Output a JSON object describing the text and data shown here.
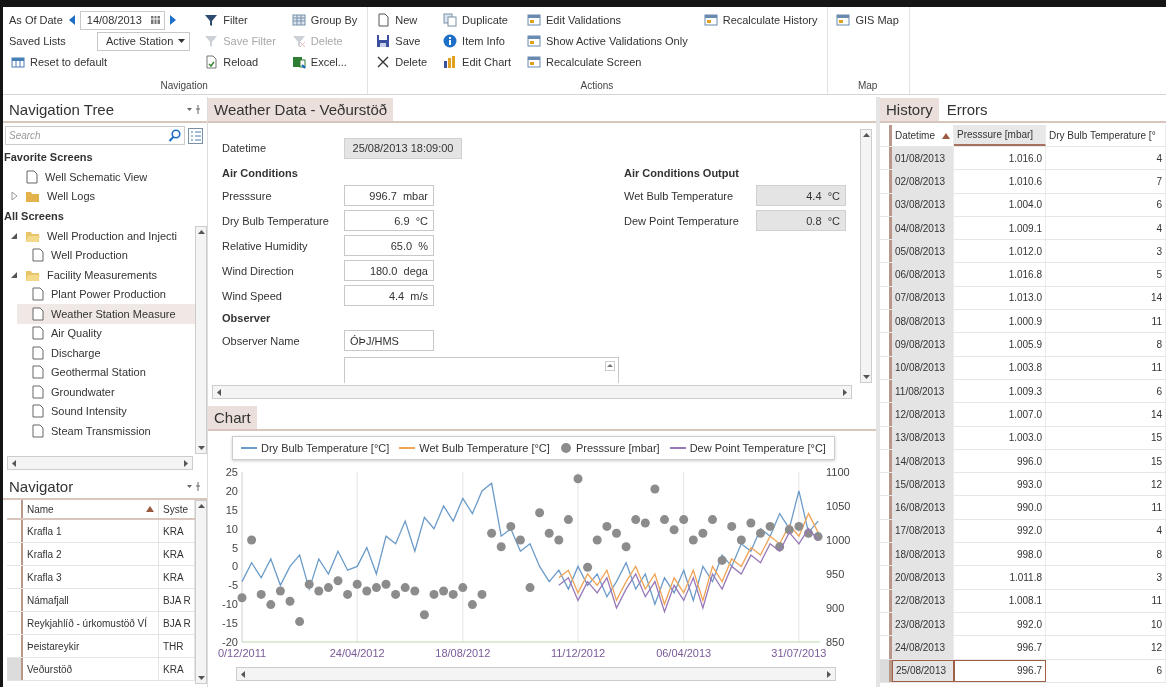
{
  "ribbon": {
    "groups": [
      {
        "label": "Navigation",
        "columns": [
          [
            {
              "kind": "date",
              "label": "As Of Date",
              "value": "14/08/2013"
            },
            {
              "kind": "dropdown",
              "label": "Saved Lists",
              "value": "Active Station"
            },
            {
              "kind": "button",
              "label": "Reset to default",
              "disabled": false
            }
          ],
          [
            {
              "kind": "button",
              "label": "Filter",
              "disabled": false
            },
            {
              "kind": "button",
              "label": "Save Filter",
              "disabled": true
            },
            {
              "kind": "button",
              "label": "Reload",
              "disabled": false
            }
          ],
          [
            {
              "kind": "button",
              "label": "Group By",
              "disabled": false
            },
            {
              "kind": "button",
              "label": "Delete",
              "disabled": true
            },
            {
              "kind": "button",
              "label": "Excel...",
              "disabled": false
            }
          ]
        ]
      },
      {
        "label": "Actions",
        "columns": [
          [
            {
              "kind": "button",
              "label": "New",
              "disabled": false
            },
            {
              "kind": "button",
              "label": "Save",
              "disabled": false
            },
            {
              "kind": "button",
              "label": "Delete",
              "disabled": false
            }
          ],
          [
            {
              "kind": "button",
              "label": "Duplicate",
              "disabled": false
            },
            {
              "kind": "button",
              "label": "Item Info",
              "disabled": false
            },
            {
              "kind": "button",
              "label": "Edit Chart",
              "disabled": false
            }
          ],
          [
            {
              "kind": "button",
              "label": "Edit Validations",
              "disabled": false
            },
            {
              "kind": "button",
              "label": "Show Active Validations Only",
              "disabled": false
            },
            {
              "kind": "button",
              "label": "Recalculate Screen",
              "disabled": false
            }
          ],
          [
            {
              "kind": "button",
              "label": "Recalculate History",
              "disabled": false
            }
          ]
        ]
      },
      {
        "label": "Map",
        "columns": [
          [
            {
              "kind": "button",
              "label": "GIS Map",
              "disabled": false
            }
          ]
        ]
      }
    ]
  },
  "navigation_tree": {
    "title": "Navigation Tree",
    "search": {
      "placeholder": "Search"
    },
    "sections": [
      {
        "label": "Favorite Screens",
        "items": [
          {
            "kind": "page",
            "label": "Well Schematic View",
            "selected": false
          },
          {
            "kind": "folder",
            "label": "Well Logs",
            "expanded": false,
            "selected": false
          }
        ]
      },
      {
        "label": "All Screens",
        "items": [
          {
            "kind": "folder",
            "label": "Well Production and Injecti",
            "expanded": true,
            "selected": false,
            "children": [
              {
                "kind": "page",
                "label": "Well Production",
                "selected": false
              }
            ]
          },
          {
            "kind": "folder",
            "label": "Facility Measurements",
            "expanded": true,
            "selected": false,
            "children": [
              {
                "kind": "page",
                "label": "Plant Power Production",
                "selected": false
              },
              {
                "kind": "page",
                "label": "Weather Station Measure",
                "selected": true
              },
              {
                "kind": "page",
                "label": "Air Quality",
                "selected": false
              },
              {
                "kind": "page",
                "label": "Discharge",
                "selected": false
              },
              {
                "kind": "page",
                "label": "Geothermal Station",
                "selected": false
              },
              {
                "kind": "page",
                "label": "Groundwater",
                "selected": false
              },
              {
                "kind": "page",
                "label": "Sound Intensity",
                "selected": false
              },
              {
                "kind": "page",
                "label": "Steam Transmission",
                "selected": false
              }
            ]
          }
        ]
      }
    ]
  },
  "navigator": {
    "title": "Navigator",
    "columns": [
      {
        "label": "Name",
        "sorted": true
      },
      {
        "label": "Syste",
        "sorted": false
      }
    ],
    "rows": [
      {
        "cells": [
          "Krafla 1",
          "KRA"
        ],
        "selected": false
      },
      {
        "cells": [
          "Krafla 2",
          "KRA"
        ],
        "selected": false
      },
      {
        "cells": [
          "Krafla 3",
          "KRA"
        ],
        "selected": false
      },
      {
        "cells": [
          "Námafjall",
          "BJA R"
        ],
        "selected": false
      },
      {
        "cells": [
          "Reykjahlíð - úrkomustöð VÍ",
          "BJA R"
        ],
        "selected": false
      },
      {
        "cells": [
          "Þeistareykir",
          "THR"
        ],
        "selected": false
      },
      {
        "cells": [
          "Veðurstöð",
          "KRA"
        ],
        "selected": true
      }
    ]
  },
  "form": {
    "title": "Weather Data - Veðurstöð",
    "left": [
      {
        "kind": "datetime",
        "label": "Datetime",
        "value": "25/08/2013 18:09:00",
        "readonly": true
      },
      {
        "kind": "heading",
        "label": "Air Conditions"
      },
      {
        "kind": "number",
        "label": "Presssure",
        "value": "996.7  mbar",
        "readonly": false
      },
      {
        "kind": "number",
        "label": "Dry Bulb Temperature",
        "value": "6.9  °C",
        "readonly": false
      },
      {
        "kind": "number",
        "label": "Relative Humidity",
        "value": "65.0  %",
        "readonly": false
      },
      {
        "kind": "number",
        "label": "Wind Direction",
        "value": "180.0  dega",
        "readonly": false
      },
      {
        "kind": "number",
        "label": "Wind Speed",
        "value": "4.4  m/s",
        "readonly": false
      },
      {
        "kind": "heading",
        "label": "Observer"
      },
      {
        "kind": "text",
        "label": "Observer Name",
        "value": "ÓÞJ/HMS",
        "readonly": false
      },
      {
        "kind": "textarea"
      }
    ],
    "right": [
      {
        "kind": "heading",
        "label": "Air Conditions Output"
      },
      {
        "kind": "number",
        "label": "Wet Bulb Temperature",
        "value": "4.4  °C",
        "readonly": true
      },
      {
        "kind": "number",
        "label": "Dew Point Temperature",
        "value": "0.8  °C",
        "readonly": true
      }
    ]
  },
  "chart": {
    "title": "Chart",
    "chart_data": {
      "type": "line",
      "categories": [
        "0/12/2011",
        null,
        null,
        null,
        null,
        null,
        null,
        null,
        null,
        null,
        null,
        null,
        "24/04/2012",
        null,
        null,
        null,
        null,
        null,
        null,
        null,
        null,
        null,
        null,
        "18/08/2012",
        null,
        null,
        null,
        null,
        null,
        null,
        null,
        null,
        null,
        null,
        null,
        "11/12/2012",
        null,
        null,
        null,
        null,
        null,
        null,
        null,
        null,
        null,
        null,
        "06/04/2013",
        null,
        null,
        null,
        null,
        null,
        null,
        null,
        null,
        null,
        null,
        null,
        "31/07/2013",
        null,
        null
      ],
      "grid": true,
      "ylim": [
        -20,
        25
      ],
      "y2lim": [
        850,
        1100
      ],
      "yticks": [
        -20,
        -15,
        -10,
        -5,
        0,
        5,
        10,
        15,
        20,
        25
      ],
      "y2ticks": [
        850,
        900,
        950,
        1000,
        1050,
        1100
      ],
      "series": [
        {
          "name": "Dry Bulb Temperature [°C]",
          "color": "#6b9bc8",
          "values": [
            -4,
            1,
            -3,
            2,
            -5,
            0,
            3,
            -6,
            2,
            -2,
            4,
            -1,
            0,
            5,
            -2,
            8,
            6,
            12,
            4,
            13,
            10,
            16,
            12,
            18,
            14,
            20,
            22,
            8,
            10,
            4,
            6,
            0,
            -4,
            -1,
            -6,
            0,
            -5,
            -2,
            -8,
            -4,
            1,
            -6,
            -2,
            -10,
            -3,
            -7,
            -1,
            -9,
            0,
            -4,
            3,
            0,
            6,
            4,
            10,
            8,
            14,
            10,
            20,
            9,
            12
          ]
        },
        {
          "name": "Wet Bulb Temperature [°C]",
          "color": "#f0a456",
          "values": [
            null,
            null,
            null,
            null,
            null,
            null,
            null,
            null,
            null,
            null,
            null,
            null,
            null,
            null,
            null,
            null,
            null,
            null,
            null,
            null,
            null,
            null,
            null,
            null,
            null,
            null,
            null,
            null,
            null,
            null,
            null,
            null,
            null,
            -3,
            -1,
            -7,
            -2,
            -5,
            -1,
            -9,
            -4,
            0,
            -6,
            -2,
            -10,
            -3,
            -7,
            -1,
            -9,
            0,
            -4,
            2,
            0,
            5,
            3,
            8,
            6,
            11,
            8,
            14,
            9
          ]
        },
        {
          "name": "Presssure [mbar]",
          "color": "#8c8c8c",
          "type": "scatter",
          "axis": "y2",
          "values": [
            915,
            1000,
            920,
            905,
            925,
            910,
            880,
            935,
            925,
            930,
            940,
            920,
            935,
            925,
            930,
            935,
            920,
            930,
            925,
            890,
            920,
            925,
            920,
            930,
            905,
            920,
            1010,
            990,
            1020,
            1000,
            930,
            1040,
            1010,
            1000,
            1030,
            1090,
            960,
            1000,
            1020,
            1010,
            990,
            1030,
            1025,
            1075,
            1030,
            1015,
            1030,
            1000,
            1010,
            1030,
            970,
            1020,
            1000,
            1025,
            1010,
            1020,
            990,
            1015,
            1020,
            1010,
            1005
          ]
        },
        {
          "name": "Dew Point Temperature [°C]",
          "color": "#9878b8",
          "values": [
            null,
            null,
            null,
            null,
            null,
            null,
            null,
            null,
            null,
            null,
            null,
            null,
            null,
            null,
            null,
            null,
            null,
            null,
            null,
            null,
            null,
            null,
            null,
            null,
            null,
            null,
            null,
            null,
            null,
            null,
            null,
            null,
            null,
            -5,
            -3,
            -9,
            -4,
            -7,
            -3,
            -11,
            -6,
            -2,
            -8,
            -4,
            -12,
            -5,
            -9,
            -3,
            -11,
            -2,
            -6,
            0,
            -2,
            3,
            1,
            6,
            4,
            9,
            6,
            10,
            7
          ]
        }
      ]
    }
  },
  "history": {
    "tabs": [
      {
        "label": "History",
        "selected": true
      },
      {
        "label": "Errors",
        "selected": false
      }
    ],
    "columns": [
      {
        "label": "Datetime",
        "sorted": true,
        "selected": false
      },
      {
        "label": "Presssure [mbar]",
        "sorted": false,
        "selected": true
      },
      {
        "label": "Dry Bulb Temperature [°",
        "sorted": false,
        "selected": false
      }
    ],
    "rows": [
      {
        "cells": [
          "01/08/2013",
          "1.016.0",
          "4"
        ],
        "selected": false
      },
      {
        "cells": [
          "02/08/2013",
          "1.010.6",
          "7"
        ],
        "selected": false
      },
      {
        "cells": [
          "03/08/2013",
          "1.004.0",
          "6"
        ],
        "selected": false
      },
      {
        "cells": [
          "04/08/2013",
          "1.009.1",
          "4"
        ],
        "selected": false
      },
      {
        "cells": [
          "05/08/2013",
          "1.012.0",
          "3"
        ],
        "selected": false
      },
      {
        "cells": [
          "06/08/2013",
          "1.016.8",
          "5"
        ],
        "selected": false
      },
      {
        "cells": [
          "07/08/2013",
          "1.013.0",
          "14"
        ],
        "selected": false
      },
      {
        "cells": [
          "08/08/2013",
          "1.000.9",
          "11"
        ],
        "selected": false
      },
      {
        "cells": [
          "09/08/2013",
          "1.005.9",
          "8"
        ],
        "selected": false
      },
      {
        "cells": [
          "10/08/2013",
          "1.003.8",
          "11"
        ],
        "selected": false
      },
      {
        "cells": [
          "11/08/2013",
          "1.009.3",
          "6"
        ],
        "selected": false
      },
      {
        "cells": [
          "12/08/2013",
          "1.007.0",
          "14"
        ],
        "selected": false
      },
      {
        "cells": [
          "13/08/2013",
          "1.003.0",
          "15"
        ],
        "selected": false
      },
      {
        "cells": [
          "14/08/2013",
          "996.0",
          "15"
        ],
        "selected": false
      },
      {
        "cells": [
          "15/08/2013",
          "993.0",
          "12"
        ],
        "selected": false
      },
      {
        "cells": [
          "16/08/2013",
          "990.0",
          "11"
        ],
        "selected": false
      },
      {
        "cells": [
          "17/08/2013",
          "992.0",
          "4"
        ],
        "selected": false
      },
      {
        "cells": [
          "18/08/2013",
          "998.0",
          "8"
        ],
        "selected": false
      },
      {
        "cells": [
          "20/08/2013",
          "1.011.8",
          "3"
        ],
        "selected": false
      },
      {
        "cells": [
          "22/08/2013",
          "1.008.1",
          "11"
        ],
        "selected": false
      },
      {
        "cells": [
          "23/08/2013",
          "992.0",
          "10"
        ],
        "selected": false
      },
      {
        "cells": [
          "24/08/2013",
          "996.7",
          "12"
        ],
        "selected": false
      },
      {
        "cells": [
          "25/08/2013",
          "996.7",
          "6"
        ],
        "selected": true
      }
    ]
  }
}
